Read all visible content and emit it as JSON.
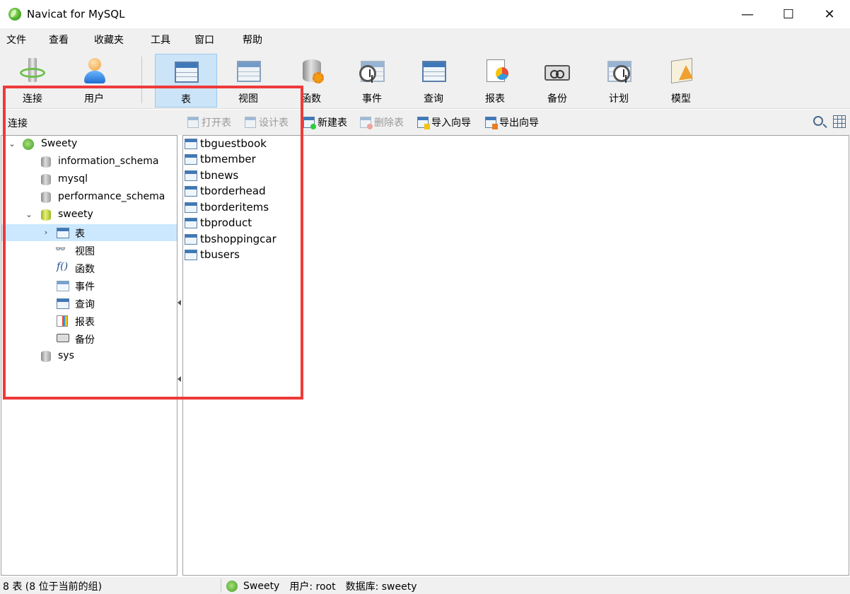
{
  "window": {
    "title": "Navicat for MySQL",
    "minimize": "—",
    "maximize": "☐",
    "close": "✕"
  },
  "menu": [
    "文件",
    "查看",
    "收藏夹",
    "工具",
    "窗口",
    "帮助"
  ],
  "toolbar": {
    "connect": "连接",
    "user": "用户",
    "table": "表",
    "view": "视图",
    "function": "函数",
    "event": "事件",
    "query": "查询",
    "report": "报表",
    "backup": "备份",
    "schedule": "计划",
    "model": "模型",
    "active": "表"
  },
  "objbar": {
    "label": "连接",
    "open_table": "打开表",
    "design_table": "设计表",
    "new_table": "新建表",
    "delete_table": "删除表",
    "import_wizard": "导入向导",
    "export_wizard": "导出向导"
  },
  "tree": {
    "connection": "Sweety",
    "databases": [
      "information_schema",
      "mysql",
      "performance_schema",
      "sweety",
      "sys"
    ],
    "sweety_children": [
      "表",
      "视图",
      "函数",
      "事件",
      "查询",
      "报表",
      "备份"
    ],
    "function_glyph": "f()"
  },
  "tables": [
    "tbguestbook",
    "tbmember",
    "tbnews",
    "tborderhead",
    "tborderitems",
    "tbproduct",
    "tbshoppingcar",
    "tbusers"
  ],
  "status": {
    "left": "8 表 (8 位于当前的组)",
    "connection": "Sweety",
    "user": "用户: root",
    "database": "数据库: sweety"
  },
  "colors": {
    "highlight_box": "#ee3a3a",
    "selection": "#cce8ff",
    "toolbar_active": "#cce4f7"
  }
}
